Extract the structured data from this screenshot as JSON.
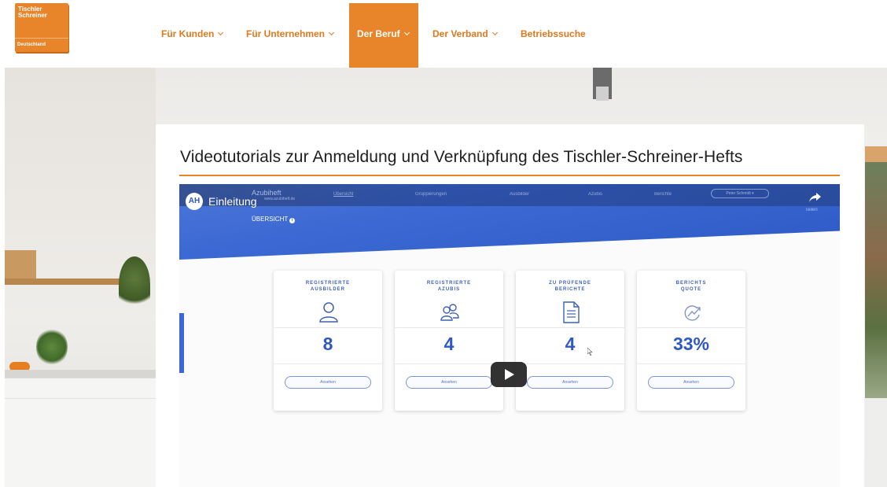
{
  "logo": {
    "line1": "Tischler",
    "line2": "Schreiner",
    "line3": "Deutschland",
    "color": "#e8852a"
  },
  "nav": {
    "items": [
      {
        "label": "Für Kunden",
        "has_dropdown": true
      },
      {
        "label": "Für Unternehmen",
        "has_dropdown": true
      },
      {
        "label": "Der Beruf",
        "has_dropdown": true,
        "active": true
      },
      {
        "label": "Der Verband",
        "has_dropdown": true
      },
      {
        "label": "Betriebssuche",
        "has_dropdown": false
      }
    ],
    "accent": "#e8852a"
  },
  "card": {
    "title": "Videotutorials zur Anmeldung und Verknüpfung des Tischler-Schreiner-Hefts"
  },
  "video": {
    "title": "Einleitung",
    "channel_icon": "azubiheft-logo-icon",
    "app": {
      "brand": "Azubiheft",
      "brand_sub": "www.azubiheft.de",
      "nav": [
        "Übersicht",
        "Gruppierungen",
        "Ausbilder",
        "Azubis",
        "Berichte"
      ],
      "user_button": "Peter Schmidt ▾",
      "section": "ÜBERSICHT",
      "stats": [
        {
          "label_1": "REGISTRIERTE",
          "label_2": "AUSBILDER",
          "value": "8",
          "button": "Ansehen",
          "icon": "user-icon"
        },
        {
          "label_1": "REGISTRIERTE",
          "label_2": "AZUBIS",
          "value": "4",
          "button": "Ansehen",
          "icon": "users-icon"
        },
        {
          "label_1": "ZU PRÜFENDE",
          "label_2": "BERICHTE",
          "value": "4",
          "button": "Ansehen",
          "icon": "document-icon"
        },
        {
          "label_1": "BERICHTS",
          "label_2": "QUOTE",
          "value": "33%",
          "button": "Ansehen",
          "icon": "chart-trend-icon"
        }
      ]
    },
    "share_label": "Teilen",
    "banner_color": "#3d69d4"
  }
}
